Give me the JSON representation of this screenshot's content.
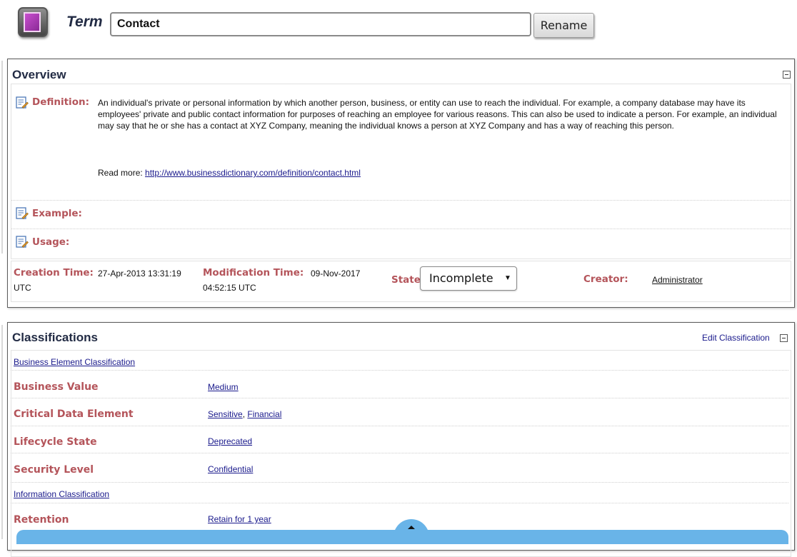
{
  "header": {
    "term_label": "Term",
    "term_value": "Contact",
    "rename_label": "Rename",
    "term_icon": "term-book-icon"
  },
  "overview": {
    "title": "Overview",
    "definition_label": "Definition:",
    "definition_text": "An individual's private or personal information by which another person, business, or entity can use to reach the individual. For example, a company database may have its employees' private and public contact information for purposes of reaching an employee for various reasons. This can also be used to indicate a person. For example, an individual may say that he or she has a contact at XYZ Company, meaning the individual knows a person at XYZ Company and has a way of reaching this person.",
    "read_more_prefix": "Read more: ",
    "read_more_link": "http://www.businessdictionary.com/definition/contact.html",
    "example_label": "Example:",
    "usage_label": "Usage:",
    "creation_label": "Creation Time:",
    "creation_value_1": "27-Apr-2013 13:31:19",
    "creation_value_2": "UTC",
    "modification_label": "Modification Time:",
    "modification_value_1": "09-Nov-2017",
    "modification_value_2": "04:52:15 UTC",
    "state_label": "State:",
    "state_value": "Incomplete",
    "creator_label": "Creator:",
    "creator_value": "Administrator"
  },
  "classifications": {
    "title": "Classifications",
    "edit_label": "Edit Classification",
    "groups": [
      {
        "name": "Business Element Classification",
        "rows": [
          {
            "label": "Business Value",
            "values": [
              "Medium"
            ]
          },
          {
            "label": "Critical Data Element",
            "values": [
              "Sensitive",
              "Financial"
            ]
          },
          {
            "label": "Lifecycle State",
            "values": [
              "Deprecated"
            ]
          },
          {
            "label": "Security Level",
            "values": [
              "Confidential"
            ]
          }
        ]
      },
      {
        "name": "Information Classification",
        "rows": [
          {
            "label": "Retention",
            "values": [
              "Retain for 1 year"
            ]
          }
        ]
      }
    ]
  },
  "colors": {
    "label": "#b4545a",
    "title": "#222b44",
    "link": "#1a1a8c",
    "bottom_bar": "#69b4e8"
  }
}
